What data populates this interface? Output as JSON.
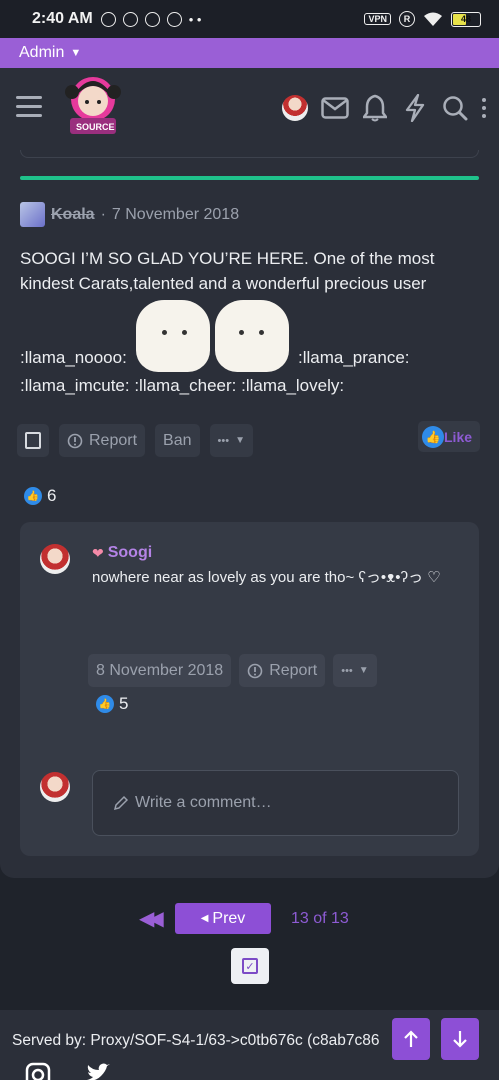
{
  "status_bar": {
    "time": "2:40 AM",
    "vpn": "VPN",
    "r_badge": "R",
    "battery": "48"
  },
  "admin_bar": {
    "label": "Admin"
  },
  "logo": {
    "text": "SOURCE"
  },
  "post": {
    "author": "Koala",
    "separator": "·",
    "date": "7 November 2018",
    "text": "SOOGI I’M SO GLAD YOU’RE HERE. One of the most kindest Carats,talented and a wonderful precious user",
    "emoji_1": ":llama_noooo:",
    "emoji_2": ":llama_prance:",
    "emoji_line2": ":llama_imcute: :llama_cheer: :llama_lovely:",
    "actions": {
      "report": "Report",
      "ban": "Ban",
      "more": "•••"
    },
    "like_label": "Like",
    "reaction_count": "6"
  },
  "reply": {
    "author": "Soogi",
    "text": "nowhere near as lovely as you are tho~ ʕっ•ᴥ•ʔっ ♡",
    "date": "8 November 2018",
    "report": "Report",
    "more": "•••",
    "reaction_count": "5"
  },
  "comment": {
    "placeholder": "Write a comment…"
  },
  "pagination": {
    "prev": "Prev",
    "info": "13 of 13"
  },
  "footer": {
    "served_by": "Served by: Proxy/SOF-S4-1/63->c0tb676c (c8ab7c86"
  },
  "colors": {
    "accent": "#8d4fd6",
    "green": "#1fc28b",
    "like_blue": "#2f8be8"
  }
}
